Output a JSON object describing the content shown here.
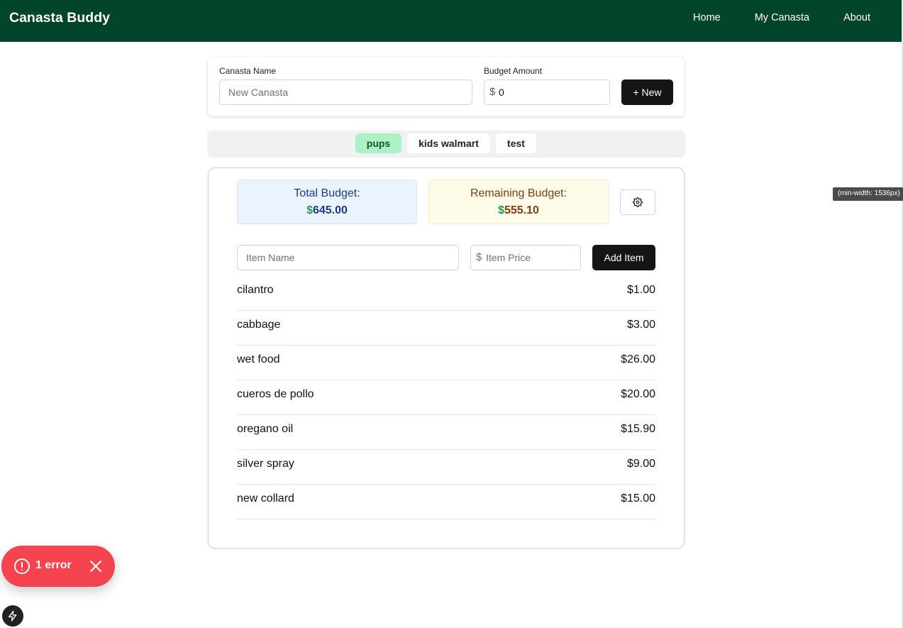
{
  "navbar": {
    "brand": "Canasta Buddy",
    "links": [
      "Home",
      "My Canasta",
      "About"
    ]
  },
  "new_canasta_form": {
    "name_label": "Canasta Name",
    "name_placeholder": "New Canasta",
    "budget_label": "Budget Amount",
    "currency_symbol": "$",
    "budget_value": "0",
    "new_button": "+ New"
  },
  "canasta_tabs": [
    {
      "label": "pups",
      "active": true
    },
    {
      "label": "kids walmart",
      "active": false
    },
    {
      "label": "test",
      "active": false
    }
  ],
  "budget_summary": {
    "total_title": "Total Budget:",
    "total_amount": "645.00",
    "remaining_title": "Remaining Budget:",
    "remaining_amount": "555.10",
    "currency_symbol": "$"
  },
  "add_item_form": {
    "item_name_placeholder": "Item Name",
    "currency_symbol": "$",
    "item_price_placeholder": "Item Price",
    "add_button": "Add Item"
  },
  "items": [
    {
      "name": "cilantro",
      "price": "$1.00"
    },
    {
      "name": "cabbage",
      "price": "$3.00"
    },
    {
      "name": "wet food",
      "price": "$26.00"
    },
    {
      "name": "cueros de pollo",
      "price": "$20.00"
    },
    {
      "name": "oregano oil",
      "price": "$15.90"
    },
    {
      "name": "silver spray",
      "price": "$9.00"
    },
    {
      "name": "new collard",
      "price": "$15.00"
    }
  ],
  "media_query_tooltip": "(min-width: 1536px)",
  "error_toast": {
    "label": "1 error"
  },
  "colors": {
    "navbar": "#03452a",
    "active_tab": "#adf0c6",
    "error": "#f5434f",
    "button_dark": "#151515"
  }
}
